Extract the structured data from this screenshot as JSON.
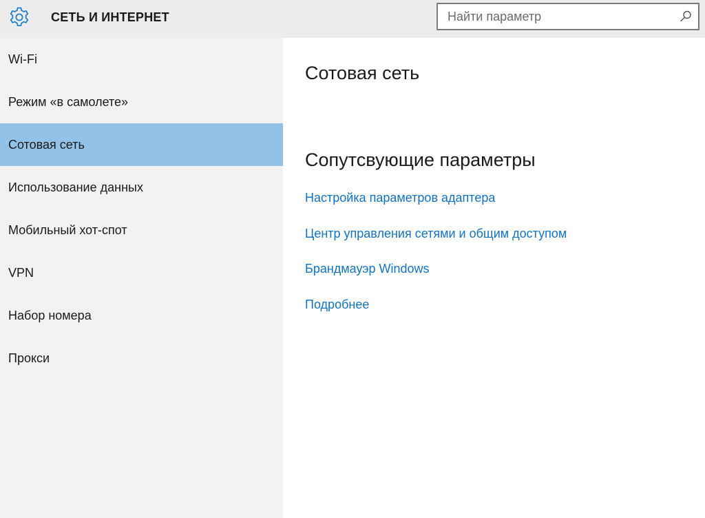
{
  "header": {
    "title": "СЕТЬ И ИНТЕРНЕТ",
    "settings_icon": "gear-icon",
    "search": {
      "placeholder": "Найти параметр",
      "value": "",
      "icon": "search-icon"
    }
  },
  "sidebar": {
    "selected_index": 2,
    "items": [
      {
        "label": "Wi-Fi"
      },
      {
        "label": "Режим «в самолете»"
      },
      {
        "label": "Сотовая сеть"
      },
      {
        "label": "Использование данных"
      },
      {
        "label": "Мобильный хот-спот"
      },
      {
        "label": "VPN"
      },
      {
        "label": "Набор номера"
      },
      {
        "label": "Прокси"
      }
    ]
  },
  "main": {
    "page_title": "Сотовая сеть",
    "related_title": "Сопутсвующие параметры",
    "links": [
      {
        "label": "Настройка параметров адаптера"
      },
      {
        "label": "Центр управления сетями и общим доступом"
      },
      {
        "label": "Брандмауэр Windows"
      },
      {
        "label": "Подробнее"
      }
    ]
  },
  "colors": {
    "header_bg": "#ececec",
    "sidebar_bg": "#f2f2f2",
    "selected_bg": "#92c2e8",
    "accent": "#1e7fd0",
    "link": "#0f73c9",
    "text": "#1a1a1a"
  }
}
